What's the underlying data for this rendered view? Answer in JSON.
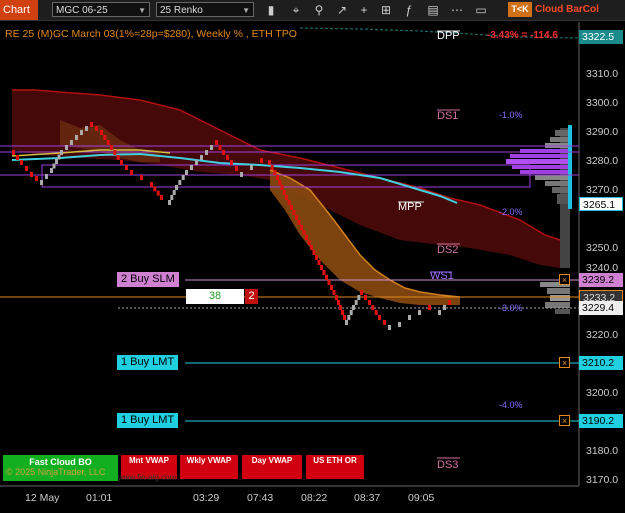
{
  "toolbar": {
    "chart_tab": "Chart",
    "instrument": "MGC 06-25",
    "bar_type": "25 Renko",
    "tok_badge": "T<K",
    "brand": "Cloud BarCol",
    "icons": [
      "bars-icon",
      "crosshair-icon",
      "zoom-icon",
      "draw-icon",
      "plus-icon",
      "grid-icon",
      "fx-icon",
      "properties-icon",
      "more-icon"
    ]
  },
  "chart": {
    "title": "RE 25 (M)GC March 03(1%=28p=$280), Weekly % , ETH TPO",
    "percent_change": "-3.43% = -114.6",
    "levels": {
      "dpp": "DPP",
      "ds1": "DS1",
      "ds2": "DS2",
      "ds3": "DS3",
      "mpp": "MPP",
      "ws1": "WS1"
    },
    "percent_labels": [
      "-1.0%",
      "-2.0%",
      "-3.0%",
      "-4.0%"
    ],
    "price_labels": {
      "top": "3322.5",
      "mpp": "3265.1",
      "slm": "3239.2",
      "last": "3233.2",
      "bid": "3229.4",
      "lmt1": "3210.2",
      "lmt2": "3190.2"
    },
    "axis_ticks": [
      "3310.0",
      "3300.0",
      "3290.0",
      "3280.0",
      "3270.0",
      "3250.0",
      "3240.0",
      "3220.0",
      "3200.0",
      "3180.0",
      "3170.0"
    ],
    "time_ticks": [
      "12 May",
      "01:01",
      "03:29",
      "07:43",
      "08:22",
      "08:37",
      "09:05"
    ],
    "orders": {
      "slm": "2 Buy SLM",
      "lmt1": "1 Buy LMT",
      "lmt2": "1 Buy LMT",
      "qty": "38",
      "qty_badge": "2"
    },
    "buttons": {
      "fast_cloud": "Fast Cloud BO",
      "copyright": "© 2025 NinjaTrader, LLC",
      "mnt_vwap": "Mnt VWAP",
      "wkly_vwap": "Wkly VWAP",
      "day_vwap": "Day VWAP",
      "us_eth_or": "US ETH OR"
    },
    "watermark": "www.fin-alg.com",
    "colors": {
      "up": "#aaaaaa",
      "down": "#e01010",
      "accent": "#d04010",
      "cloud": "#c06a10",
      "vwap": "#40d0e0",
      "profile": "#a040e0"
    }
  }
}
